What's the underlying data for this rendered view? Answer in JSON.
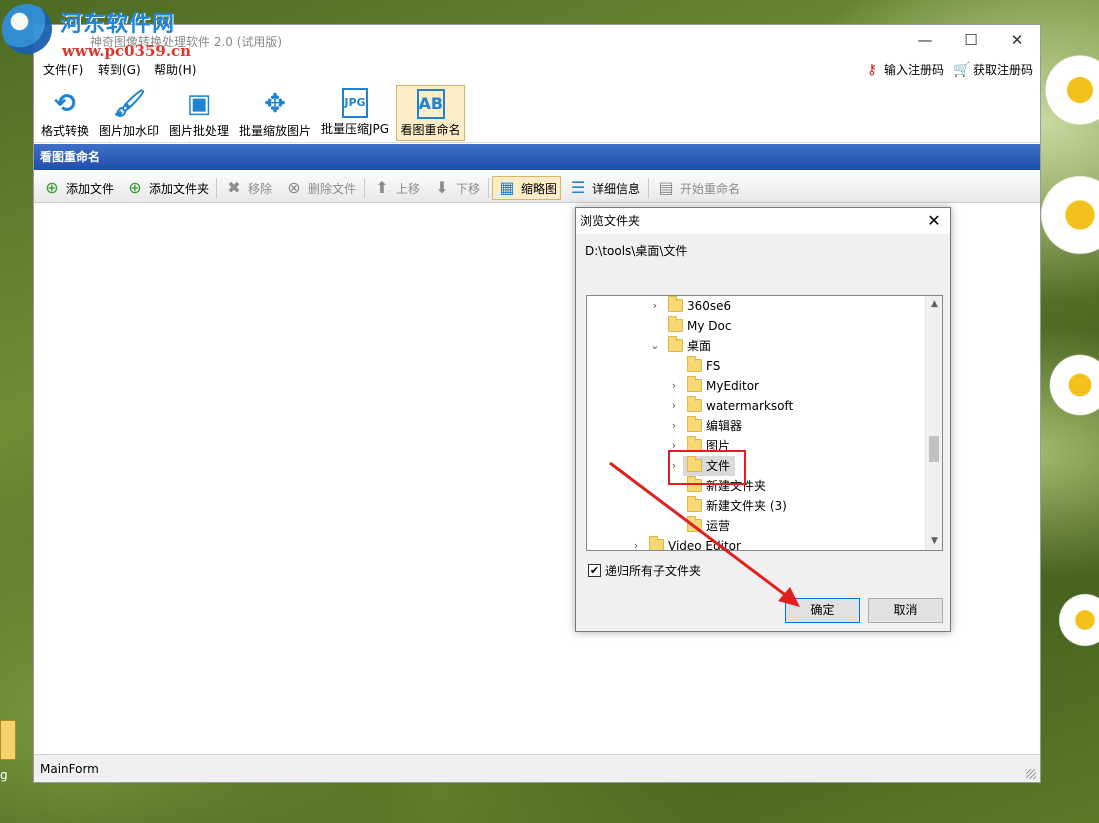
{
  "watermark": {
    "site_name": "河东软件网",
    "url": "www.pc0359.cn"
  },
  "window": {
    "title": "神奇图像转换处理软件 2.0 (试用版)",
    "controls": {
      "minimize": "—",
      "maximize": "☐",
      "close": "✕"
    }
  },
  "menu": {
    "items": [
      {
        "label": "文件(F)"
      },
      {
        "label": "转到(G)"
      },
      {
        "label": "帮助(H)"
      }
    ],
    "register": "输入注册码",
    "buy": "获取注册码"
  },
  "toolbar": {
    "items": [
      {
        "label": "格式转换",
        "icon": "convert-icon"
      },
      {
        "label": "图片加水印",
        "icon": "brush-icon"
      },
      {
        "label": "图片批处理",
        "icon": "image-icon"
      },
      {
        "label": "批量缩放图片",
        "icon": "move-arrows-icon"
      },
      {
        "label": "批量压缩JPG",
        "icon": "jpg-file-icon"
      },
      {
        "label": "看图重命名",
        "icon": "rename-icon"
      }
    ]
  },
  "section": {
    "title": "看图重命名"
  },
  "subtoolbar": {
    "add_file": "添加文件",
    "add_folder": "添加文件夹",
    "remove": "移除",
    "delete_file": "删除文件",
    "move_up": "上移",
    "move_down": "下移",
    "thumbnail": "缩略图",
    "details": "详细信息",
    "start_rename": "开始重命名"
  },
  "status": {
    "text": "MainForm"
  },
  "dialog": {
    "title": "浏览文件夹",
    "close": "✕",
    "path": "D:\\tools\\桌面\\文件",
    "tree": [
      {
        "label": "360se6"
      },
      {
        "label": "My Doc"
      },
      {
        "label": "桌面"
      },
      {
        "label": "FS"
      },
      {
        "label": "MyEditor"
      },
      {
        "label": "watermarksoft"
      },
      {
        "label": "编辑器"
      },
      {
        "label": "图片"
      },
      {
        "label": "文件"
      },
      {
        "label": "新建文件夹"
      },
      {
        "label": "新建文件夹 (3)"
      },
      {
        "label": "运营"
      },
      {
        "label": "Video Editor"
      }
    ],
    "recurse_label": "递归所有子文件夹",
    "recurse_checked": true,
    "ok": "确定",
    "cancel": "取消"
  },
  "desktop": {
    "icon_label": "g"
  },
  "colors": {
    "header_blue": "#1f4fa8",
    "highlight_red": "#e02020",
    "toolbar_icon_blue": "#1d83d4"
  }
}
